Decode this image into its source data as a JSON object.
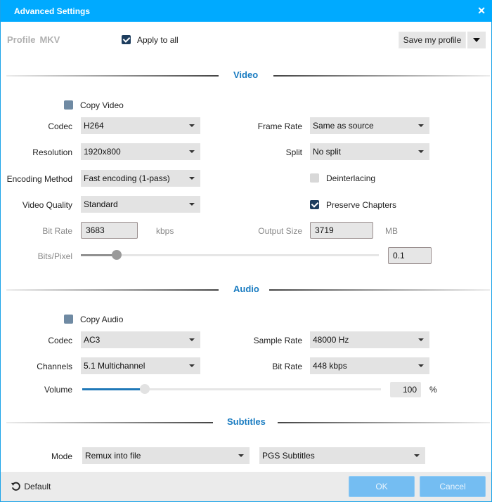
{
  "window": {
    "title": "Advanced Settings",
    "close_icon": "close-icon"
  },
  "header": {
    "profile_label": "Profile",
    "profile_value": "MKV",
    "apply_to_all": {
      "label": "Apply to all",
      "checked": true
    },
    "save_profile_label": "Save my profile",
    "save_dropdown_icon": "caret-down-icon"
  },
  "video": {
    "section_title": "Video",
    "copy_video": {
      "label": "Copy Video",
      "checked": false
    },
    "codec": {
      "label": "Codec",
      "value": "H264"
    },
    "resolution": {
      "label": "Resolution",
      "value": "1920x800"
    },
    "encoding_method": {
      "label": "Encoding Method",
      "value": "Fast encoding (1-pass)"
    },
    "video_quality": {
      "label": "Video Quality",
      "value": "Standard"
    },
    "frame_rate": {
      "label": "Frame Rate",
      "value": "Same as source"
    },
    "split": {
      "label": "Split",
      "value": "No split"
    },
    "deinterlacing": {
      "label": "Deinterlacing",
      "checked": false
    },
    "preserve_chapters": {
      "label": "Preserve Chapters",
      "checked": true
    },
    "bit_rate": {
      "label": "Bit Rate",
      "value": "3683",
      "unit": "kbps"
    },
    "output_size": {
      "label": "Output Size",
      "value": "3719",
      "unit": "MB"
    },
    "bits_per_pixel": {
      "label": "Bits/Pixel",
      "value": "0.1",
      "slider_fraction": 0.12
    }
  },
  "audio": {
    "section_title": "Audio",
    "copy_audio": {
      "label": "Copy Audio",
      "checked": false
    },
    "codec": {
      "label": "Codec",
      "value": "AC3"
    },
    "channels": {
      "label": "Channels",
      "value": "5.1 Multichannel"
    },
    "sample_rate": {
      "label": "Sample Rate",
      "value": "48000 Hz"
    },
    "bit_rate": {
      "label": "Bit Rate",
      "value": "448 kbps"
    },
    "volume": {
      "label": "Volume",
      "value": "100",
      "unit": "%",
      "slider_fraction": 0.21
    }
  },
  "subtitles": {
    "section_title": "Subtitles",
    "mode": {
      "label": "Mode",
      "value": "Remux into file"
    },
    "format": {
      "value": "PGS Subtitles"
    }
  },
  "footer": {
    "default_label": "Default",
    "ok_label": "OK",
    "cancel_label": "Cancel"
  },
  "colors": {
    "titlebar": "#00aaff",
    "section_title": "#1a7cc1",
    "volume_fill": "#1f78b8",
    "bits_fill": "#909090",
    "primary_button": "#74bdf2"
  }
}
